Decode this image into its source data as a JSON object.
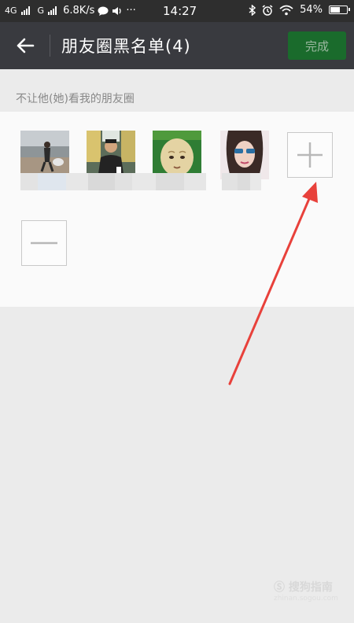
{
  "status_bar": {
    "network1": "4G",
    "network2": "G",
    "speed": "6.8K/s",
    "dots": "···",
    "time": "14:27",
    "battery_percent": "54%",
    "battery_level": 0.54
  },
  "title_bar": {
    "title": "朋友圈黑名单(4)",
    "done_label": "完成"
  },
  "section": {
    "header": "不让他(她)看我的朋友圈"
  },
  "members": [
    {
      "name": "",
      "avatar": "person-at-beach"
    },
    {
      "name": "",
      "avatar": "person-in-vehicle"
    },
    {
      "name": "",
      "avatar": "bald-face"
    },
    {
      "name": "",
      "avatar": "woman-sunglasses"
    }
  ],
  "actions": {
    "add_symbol": "+",
    "remove_symbol": "−"
  },
  "watermark": {
    "text": "搜狗指南",
    "url": "zhinan.sogou.com"
  },
  "colors": {
    "status_bar": "#2e2e2e",
    "title_bar": "#393a3f",
    "done_button": "#1a6b2c",
    "background": "#ebebeb",
    "annotation_arrow": "#e8413b"
  }
}
